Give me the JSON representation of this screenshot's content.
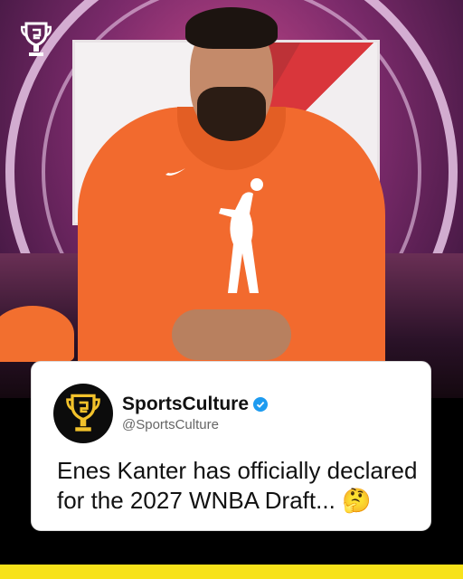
{
  "tweet": {
    "display_name": "SportsCulture",
    "handle": "@SportsCulture",
    "text": "Enes Kanter has officially declared for the 2027 WNBA Draft...",
    "emoji": "🤔",
    "verified_icon": "verified-badge-icon"
  },
  "brand": {
    "logo_icon": "trophy-logo-icon"
  },
  "colors": {
    "hoodie_orange": "#f26a2e",
    "accent_yellow": "#f7e21a",
    "verified_blue": "#1d9bf0",
    "card_bg": "#ffffff"
  }
}
